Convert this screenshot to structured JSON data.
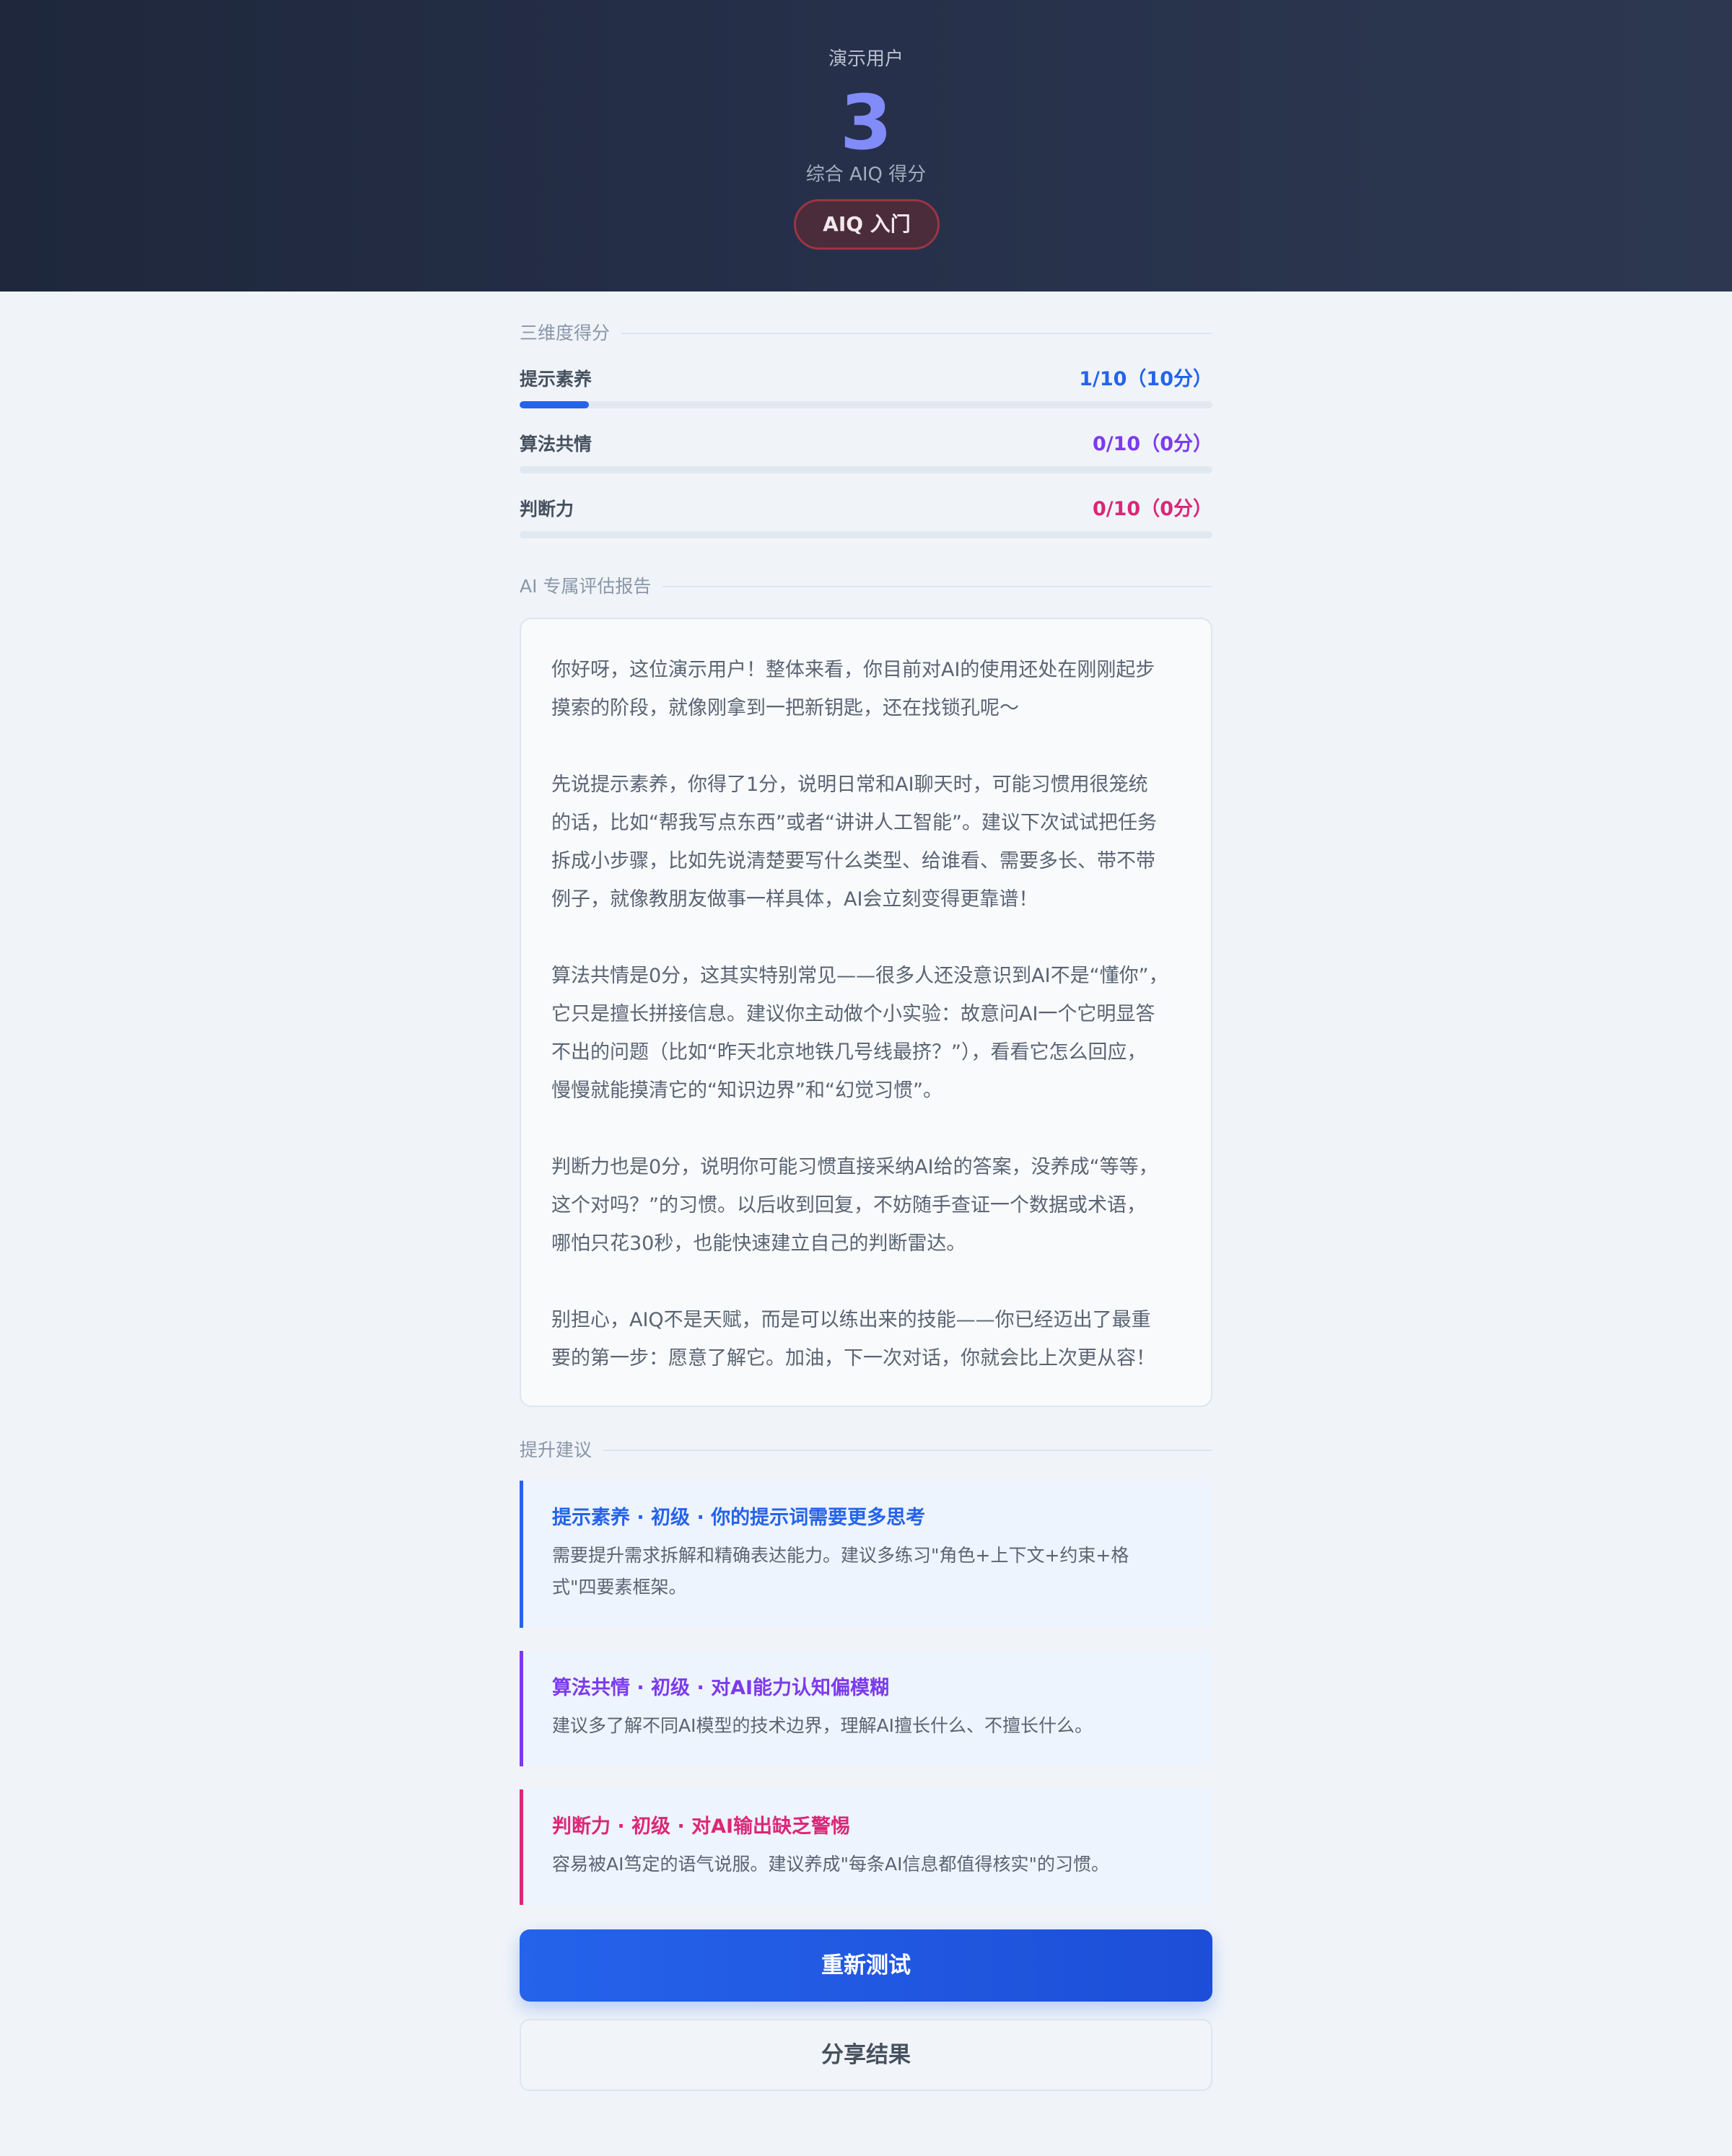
{
  "header": {
    "user_name": "演示用户",
    "score": "3",
    "score_label": "综合 AIQ 得分",
    "level_badge": "AIQ 入门"
  },
  "dimensions": {
    "title": "三维度得分",
    "items": [
      {
        "name": "提示素养",
        "value_text": "1/10（10分）",
        "score": 1,
        "max": 10,
        "color": "#2563eb"
      },
      {
        "name": "算法共情",
        "value_text": "0/10（0分）",
        "score": 0,
        "max": 10,
        "color": "#7c3aed"
      },
      {
        "name": "判断力",
        "value_text": "0/10（0分）",
        "score": 0,
        "max": 10,
        "color": "#db2777"
      }
    ]
  },
  "report": {
    "title": "AI 专属评估报告",
    "paragraphs": [
      [
        "你好呀，这位演示用户！整体来看，你目前对AI的使用还处在刚刚起步",
        "摸索的阶段，就像刚拿到一把新钥匙，还在找锁孔呢～"
      ],
      [
        "先说提示素养，你得了1分，说明日常和AI聊天时，可能习惯用很笼统",
        "的话，比如“帮我写点东西”或者“讲讲人工智能”。建议下次试试把任务",
        "拆成小步骤，比如先说清楚要写什么类型、给谁看、需要多长、带不带",
        "例子，就像教朋友做事一样具体，AI会立刻变得更靠谱！"
      ],
      [
        "算法共情是0分，这其实特别常见——很多人还没意识到AI不是“懂你”，",
        "它只是擅长拼接信息。建议你主动做个小实验：故意问AI一个它明显答",
        "不出的问题（比如“昨天北京地铁几号线最挤？”），看看它怎么回应，",
        "慢慢就能摸清它的“知识边界”和“幻觉习惯”。"
      ],
      [
        "判断力也是0分，说明你可能习惯直接采纳AI给的答案，没养成“等等，",
        "这个对吗？”的习惯。以后收到回复，不妨随手查证一个数据或术语，",
        "哪怕只花30秒，也能快速建立自己的判断雷达。"
      ],
      [
        "别担心，AIQ不是天赋，而是可以练出来的技能——你已经迈出了最重",
        "要的第一步：愿意了解它。加油，下一次对话，你就会比上次更从容！"
      ]
    ]
  },
  "suggestions": {
    "title": "提升建议",
    "items": [
      {
        "title": "提示素养 · 初级 · 你的提示词需要更多思考",
        "body_lines": [
          "需要提升需求拆解和精确表达能力。建议多练习\"角色+上下文+约束+格",
          "式\"四要素框架。"
        ],
        "color": "#2563eb"
      },
      {
        "title": "算法共情 · 初级 · 对AI能力认知偏模糊",
        "body_lines": [
          "建议多了解不同AI模型的技术边界，理解AI擅长什么、不擅长什么。"
        ],
        "color": "#7c3aed"
      },
      {
        "title": "判断力 · 初级 · 对AI输出缺乏警惕",
        "body_lines": [
          "容易被AI笃定的语气说服。建议养成\"每条AI信息都值得核实\"的习惯。"
        ],
        "color": "#db2777"
      }
    ]
  },
  "actions": {
    "retest": "重新测试",
    "share": "分享结果"
  }
}
